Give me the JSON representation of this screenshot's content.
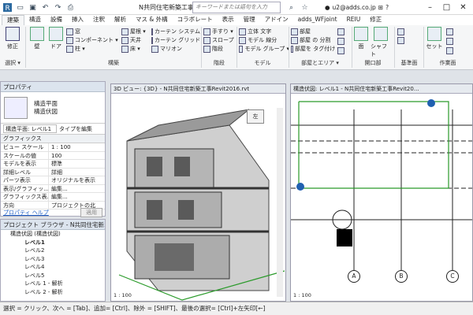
{
  "app": {
    "title": "N共同住宅新築工事...",
    "search_placeholder": "キーワードまたは語句を入力",
    "user": "u2@adds.co.jp"
  },
  "icons": {
    "app_menu": "revit-logo-icon",
    "open": "open-icon",
    "save": "save-icon",
    "undo": "undo-icon",
    "redo": "redo-icon",
    "print": "print-icon",
    "search": "search-icon",
    "star": "star-icon",
    "user": "user-icon",
    "cart": "cart-icon",
    "help": "help-icon"
  },
  "tabs": [
    "建築",
    "構造",
    "設備",
    "挿入",
    "注釈",
    "解析",
    "マス & 外構",
    "コラボレート",
    "表示",
    "管理",
    "アドイン",
    "adds_WFjoint",
    "REIU",
    "修正"
  ],
  "ribbon": {
    "modify": "修正",
    "select": "選択 ▾",
    "wall": "壁",
    "door": "ドア",
    "window": "窓",
    "component": "コンポーネント ▾",
    "column": "柱 ▾",
    "roof": "屋根 ▾",
    "ceiling": "天井",
    "floor": "床 ▾",
    "curtain_system": "カーテン システム",
    "curtain_grid": "カーテン グリッド",
    "mullion": "マリオン",
    "railing": "手すり ▾",
    "ramp": "スロープ",
    "stair": "階段",
    "model_text": "立体 文字",
    "model_line": "モデル 線分",
    "model_group": "モデル グループ ▾",
    "room": "部屋",
    "room_sep": "部屋 の 分割",
    "room_tag": "部屋を タグ付け ▾",
    "shaft": "シャフト",
    "opening_face": "面",
    "level": "レベル",
    "grid": "通芯",
    "set": "セット",
    "groups": {
      "build": "構築",
      "circulation": "階段",
      "model": "モデル",
      "room_area": "部屋とエリア ▾",
      "opening": "開口部",
      "datum": "基準面",
      "workplane": "作業面"
    }
  },
  "properties": {
    "title": "プロパティ",
    "type_name": "構造平面",
    "type_sub": "構造伏図",
    "selector": "構造平面: レベル1",
    "edit_type": "タイプを編集",
    "section": "グラフィックス",
    "rows": [
      {
        "k": "ビュー スケール",
        "v": "1 : 100"
      },
      {
        "k": "スケールの値",
        "v": "100"
      },
      {
        "k": "モデルを表示",
        "v": "標準"
      },
      {
        "k": "詳細レベル",
        "v": "詳細"
      },
      {
        "k": "パーツ表示",
        "v": "オリジナルを表示"
      },
      {
        "k": "表示/グラフィッ...",
        "v": "編集..."
      },
      {
        "k": "グラフィックス表...",
        "v": "編集..."
      },
      {
        "k": "方向",
        "v": "プロジェクトの北"
      }
    ],
    "help": "プロパティ ヘルプ",
    "apply": "適用"
  },
  "browser": {
    "title": "プロジェクト ブラウザ - N共同住宅新...",
    "items": [
      "構造伏図 (構造伏図)",
      "レベル1",
      "レベル2",
      "レベル3",
      "レベル4",
      "レベル5",
      "レベル 1 - 解析",
      "レベル 2 - 解析"
    ]
  },
  "views": {
    "v3d_title": "3D ビュー: {3D} - N共同住宅新築工事Revit2016.rvt",
    "plan_title": "構造伏図: レベル1 - N共同住宅新築工事Revit20...",
    "v3d_scale": "1 : 100",
    "plan_scale": "1 : 100",
    "viewcube": "左",
    "grids": [
      "A",
      "B",
      "C"
    ]
  },
  "status": "選択 = クリック、次へ = [Tab]、追加= [Ctrl]、除外 = [SHIFT]、最後の選択= [Ctrl]+左矢印[←]"
}
